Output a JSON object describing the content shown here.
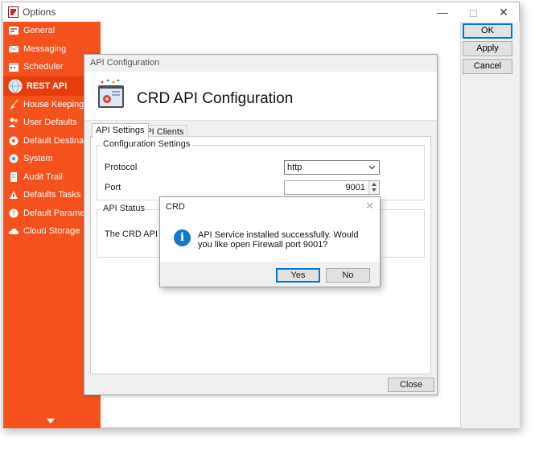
{
  "window": {
    "title": "Options",
    "controls": {
      "minimize": "—",
      "close": "✕"
    }
  },
  "sidebar": {
    "items": [
      {
        "label": "General",
        "icon": "general-icon"
      },
      {
        "label": "Messaging",
        "icon": "messaging-icon"
      },
      {
        "label": "Scheduler",
        "icon": "scheduler-icon"
      },
      {
        "label": "REST API",
        "icon": "globe-icon",
        "active": true
      },
      {
        "label": "House Keeping",
        "icon": "broom-icon"
      },
      {
        "label": "User Defaults",
        "icon": "users-icon"
      },
      {
        "label": "Default Destinations",
        "icon": "destinations-icon"
      },
      {
        "label": "System",
        "icon": "system-icon"
      },
      {
        "label": "Audit Trail",
        "icon": "audit-icon"
      },
      {
        "label": "Defaults Tasks",
        "icon": "tasks-icon"
      },
      {
        "label": "Default Parameters",
        "icon": "parameters-icon"
      },
      {
        "label": "Cloud Storage",
        "icon": "cloud-icon"
      }
    ]
  },
  "side_buttons": {
    "ok": "OK",
    "apply": "Apply",
    "cancel": "Cancel"
  },
  "api_window": {
    "title": "API Configuration",
    "header_title": "CRD API Configuration",
    "tabs": [
      "API Settings",
      "API Clients"
    ],
    "config_group": "Configuration Settings",
    "protocol_label": "Protocol",
    "protocol_value": "http",
    "port_label": "Port",
    "port_value": "9001",
    "status_group": "API Status",
    "status_text": "The CRD API Servic",
    "close_button": "Close"
  },
  "dialog": {
    "title": "CRD",
    "close": "✕",
    "icon": "info-icon",
    "icon_glyph": "i",
    "message": "API Service installed successfully. Would you like open Firewall port 9001?",
    "yes": "Yes",
    "no": "No"
  },
  "colors": {
    "sidebar": "#f4511e",
    "sidebar_active": "#e63d0c",
    "info_blue": "#1677cf",
    "focus_blue": "#0078d7"
  }
}
